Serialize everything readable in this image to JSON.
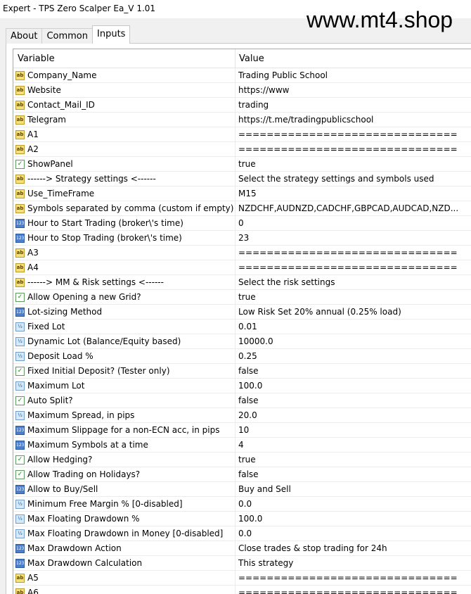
{
  "window": {
    "title": "Expert - TPS Zero Scalper Ea_V 1.01"
  },
  "watermark": "www.mt4.shop",
  "tabs": [
    {
      "label": "About"
    },
    {
      "label": "Common"
    },
    {
      "label": "Inputs"
    }
  ],
  "active_tab": "Inputs",
  "table": {
    "headers": {
      "variable": "Variable",
      "value": "Value"
    },
    "rows": [
      {
        "icon": "ab",
        "name": "Company_Name",
        "value": "Trading Public School"
      },
      {
        "icon": "ab",
        "name": "Website",
        "value": "https://www"
      },
      {
        "icon": "ab",
        "name": "Contact_Mail_ID",
        "value": "trading"
      },
      {
        "icon": "ab",
        "name": "Telegram",
        "value": "https://t.me/tradingpublicschool"
      },
      {
        "icon": "ab",
        "name": "A1",
        "value": "===================================="
      },
      {
        "icon": "ab",
        "name": "A2",
        "value": "===================================="
      },
      {
        "icon": "bool",
        "name": "ShowPanel",
        "value": "true"
      },
      {
        "icon": "ab",
        "name": "------> Strategy settings <------",
        "value": "Select the strategy settings and symbols used"
      },
      {
        "icon": "ab",
        "name": "Use_TimeFrame",
        "value": "M15"
      },
      {
        "icon": "ab",
        "name": "Symbols separated by comma (custom if empty)",
        "value": "NZDCHF,AUDNZD,CADCHF,GBPCAD,AUDCAD,NZD..."
      },
      {
        "icon": "num",
        "name": "Hour to Start Trading (broker\\'s time)",
        "value": "0"
      },
      {
        "icon": "num",
        "name": "Hour to Stop Trading (broker\\'s time)",
        "value": "23"
      },
      {
        "icon": "ab",
        "name": "A3",
        "value": "===================================="
      },
      {
        "icon": "ab",
        "name": "A4",
        "value": "===================================="
      },
      {
        "icon": "ab",
        "name": "------> MM & Risk settings <------",
        "value": "Select the risk settings"
      },
      {
        "icon": "bool",
        "name": "Allow Opening a new Grid?",
        "value": "true"
      },
      {
        "icon": "num",
        "name": "Lot-sizing Method",
        "value": "Low Risk Set 20% annual (0.25% load)"
      },
      {
        "icon": "dbl",
        "name": "Fixed Lot",
        "value": "0.01"
      },
      {
        "icon": "dbl",
        "name": "Dynamic Lot (Balance/Equity based)",
        "value": "10000.0"
      },
      {
        "icon": "dbl",
        "name": "Deposit Load %",
        "value": "0.25"
      },
      {
        "icon": "bool",
        "name": "Fixed Initial Deposit? (Tester only)",
        "value": "false"
      },
      {
        "icon": "dbl",
        "name": "Maximum Lot",
        "value": "100.0"
      },
      {
        "icon": "bool",
        "name": "Auto Split?",
        "value": "false"
      },
      {
        "icon": "dbl",
        "name": "Maximum Spread, in pips",
        "value": "20.0"
      },
      {
        "icon": "num",
        "name": "Maximum Slippage for a non-ECN acc, in pips",
        "value": "10"
      },
      {
        "icon": "num",
        "name": "Maximum Symbols at a time",
        "value": "4"
      },
      {
        "icon": "bool",
        "name": "Allow Hedging?",
        "value": "true"
      },
      {
        "icon": "bool",
        "name": "Allow Trading on Holidays?",
        "value": "false"
      },
      {
        "icon": "num",
        "name": "Allow to Buy/Sell",
        "value": "Buy and Sell"
      },
      {
        "icon": "dbl",
        "name": "Minimum Free Margin % [0-disabled]",
        "value": "0.0"
      },
      {
        "icon": "dbl",
        "name": "Max Floating Drawdown %",
        "value": "100.0"
      },
      {
        "icon": "dbl",
        "name": "Max Floating Drawdown in Money [0-disabled]",
        "value": "0.0"
      },
      {
        "icon": "num",
        "name": "Max Drawdown Action",
        "value": "Close trades & stop trading for 24h"
      },
      {
        "icon": "num",
        "name": "Max Drawdown Calculation",
        "value": "This strategy"
      },
      {
        "icon": "ab",
        "name": "A5",
        "value": "===================================="
      },
      {
        "icon": "ab",
        "name": "A6",
        "value": "===================================="
      }
    ]
  },
  "icon_glyphs": {
    "ab": "ab",
    "num": "123",
    "bool": "✓",
    "dbl": "½"
  }
}
